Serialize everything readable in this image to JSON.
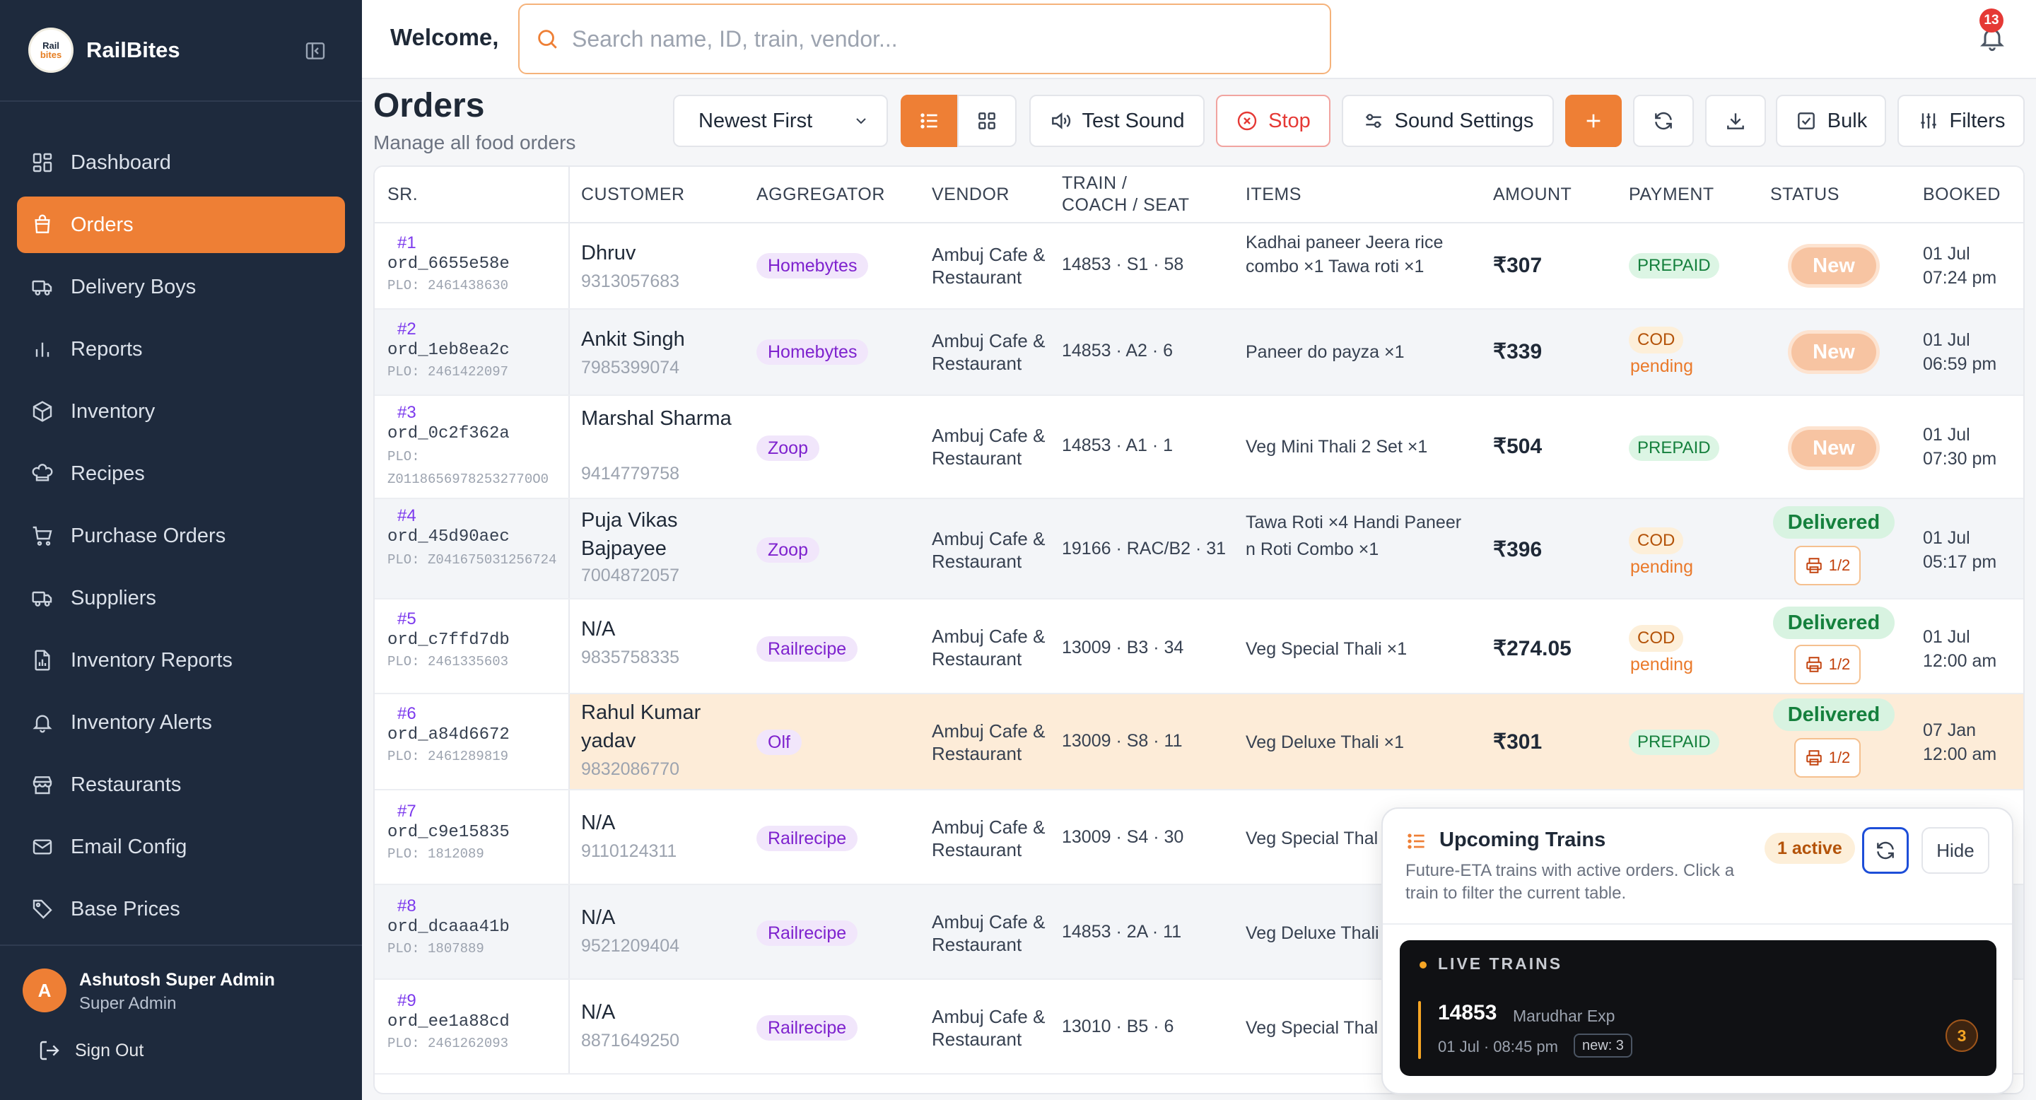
{
  "app": {
    "brand": "RailBites",
    "logo_top": "Rail",
    "logo_bottom": "bites"
  },
  "sidebar": {
    "items": [
      {
        "label": "Dashboard",
        "icon": "grid-icon"
      },
      {
        "label": "Orders",
        "icon": "bag-icon",
        "active": true
      },
      {
        "label": "Delivery Boys",
        "icon": "truck-icon"
      },
      {
        "label": "Reports",
        "icon": "bar-chart-icon"
      },
      {
        "label": "Inventory",
        "icon": "box-icon"
      },
      {
        "label": "Recipes",
        "icon": "chef-hat-icon"
      },
      {
        "label": "Purchase Orders",
        "icon": "cart-icon"
      },
      {
        "label": "Suppliers",
        "icon": "truck-icon"
      },
      {
        "label": "Inventory Reports",
        "icon": "file-chart-icon"
      },
      {
        "label": "Inventory Alerts",
        "icon": "bell-icon"
      },
      {
        "label": "Restaurants",
        "icon": "store-icon"
      },
      {
        "label": "Email Config",
        "icon": "mail-icon"
      },
      {
        "label": "Base Prices",
        "icon": "tag-icon"
      }
    ],
    "user": {
      "initial": "A",
      "name": "Ashutosh Super Admin",
      "role": "Super Admin"
    },
    "signout": "Sign Out"
  },
  "topbar": {
    "welcome": "Welcome,",
    "search_placeholder": "Search name, ID, train, vendor...",
    "notifications": "13"
  },
  "page": {
    "title": "Orders",
    "subtitle": "Manage all food orders"
  },
  "toolbar": {
    "sort": "Newest First",
    "test_sound": "Test Sound",
    "stop": "Stop",
    "sound_settings": "Sound Settings",
    "bulk": "Bulk",
    "filters": "Filters"
  },
  "columns": {
    "sr": "SR.",
    "customer": "CUSTOMER",
    "aggregator": "AGGREGATOR",
    "vendor": "VENDOR",
    "train_line1": "TRAIN /",
    "train_line2": "COACH / SEAT",
    "items": "ITEMS",
    "amount": "AMOUNT",
    "payment": "PAYMENT",
    "status": "STATUS",
    "booked": "BOOKED"
  },
  "orders": [
    {
      "sr": "#1",
      "id": "ord_6655e58e",
      "plo": "PLO: 2461438630",
      "name": "Dhruv",
      "phone": "9313057683",
      "aggregator": "Homebytes",
      "vendor": "Ambuj Cafe & Restaurant",
      "train": "14853 · S1 · 58",
      "items": "Kadhai paneer Jeera rice combo ×1 Tawa roti ×1",
      "amount": "₹307",
      "payment": "PREPAID",
      "status": "New",
      "date": "01 Jul",
      "time": "07:24 pm"
    },
    {
      "sr": "#2",
      "id": "ord_1eb8ea2c",
      "plo": "PLO: 2461422097",
      "name": "Ankit Singh",
      "phone": "7985399074",
      "aggregator": "Homebytes",
      "vendor": "Ambuj Cafe & Restaurant",
      "train": "14853 · A2 · 6",
      "items": "Paneer do payza ×1",
      "amount": "₹339",
      "payment": "COD",
      "payment_sub": "pending",
      "status": "New",
      "date": "01 Jul",
      "time": "06:59 pm"
    },
    {
      "sr": "#3",
      "id": "ord_0c2f362a",
      "plo": "PLO: Z01186569782532770O0",
      "name": "Marshal Sharma",
      "phone": "9414779758",
      "aggregator": "Zoop",
      "vendor": "Ambuj Cafe & Restaurant",
      "train": "14853 · A1 · 1",
      "items": "Veg Mini Thali 2 Set ×1",
      "amount": "₹504",
      "payment": "PREPAID",
      "status": "New",
      "date": "01 Jul",
      "time": "07:30 pm"
    },
    {
      "sr": "#4",
      "id": "ord_45d90aec",
      "plo": "PLO: Z041675031256724",
      "name": "Puja Vikas Bajpayee",
      "phone": "7004872057",
      "aggregator": "Zoop",
      "vendor": "Ambuj Cafe & Restaurant",
      "train": "19166 · RAC/B2 · 31",
      "items": "Tawa Roti ×4 Handi Paneer n Roti Combo ×1",
      "amount": "₹396",
      "payment": "COD",
      "payment_sub": "pending",
      "status": "Delivered",
      "print": "1/2",
      "date": "01 Jul",
      "time": "05:17 pm"
    },
    {
      "sr": "#5",
      "id": "ord_c7ffd7db",
      "plo": "PLO: 2461335603",
      "name": "N/A",
      "phone": "9835758335",
      "aggregator": "Railrecipe",
      "vendor": "Ambuj Cafe & Restaurant",
      "train": "13009 · B3 · 34",
      "items": "Veg Special Thali ×1",
      "amount": "₹274.05",
      "payment": "COD",
      "payment_sub": "pending",
      "status": "Delivered",
      "print": "1/2",
      "date": "01 Jul",
      "time": "12:00 am"
    },
    {
      "sr": "#6",
      "id": "ord_a84d6672",
      "plo": "PLO: 2461289819",
      "name": "Rahul Kumar yadav",
      "phone": "9832086770",
      "aggregator": "Olf",
      "vendor": "Ambuj Cafe & Restaurant",
      "train": "13009 · S8 · 11",
      "items": "Veg Deluxe Thali ×1",
      "amount": "₹301",
      "payment": "PREPAID",
      "status": "Delivered",
      "print": "1/2",
      "date": "07 Jan",
      "time": "12:00 am"
    },
    {
      "sr": "#7",
      "id": "ord_c9e15835",
      "plo": "PLO: 1812089",
      "name": "N/A",
      "phone": "9110124311",
      "aggregator": "Railrecipe",
      "vendor": "Ambuj Cafe & Restaurant",
      "train": "13009 · S4 · 30",
      "items": "Veg Special Thal"
    },
    {
      "sr": "#8",
      "id": "ord_dcaaa41b",
      "plo": "PLO: 1807889",
      "name": "N/A",
      "phone": "9521209404",
      "aggregator": "Railrecipe",
      "vendor": "Ambuj Cafe & Restaurant",
      "train": "14853 · 2A · 11",
      "items": "Veg Deluxe Thali"
    },
    {
      "sr": "#9",
      "id": "ord_ee1a88cd",
      "plo": "PLO: 2461262093",
      "name": "N/A",
      "phone": "8871649250",
      "aggregator": "Railrecipe",
      "vendor": "Ambuj Cafe & Restaurant",
      "train": "13010 · B5 · 6",
      "items": "Veg Special Thal"
    }
  ],
  "upcoming": {
    "title": "Upcoming Trains",
    "description": "Future-ETA trains with active orders. Click a train to filter the current table.",
    "active": "1 active",
    "hide": "Hide",
    "live_title": "LIVE TRAINS",
    "train": {
      "number": "14853",
      "name": "Marudhar Exp",
      "time": "01 Jul · 08:45 pm",
      "new": "new: 3",
      "count": "3"
    }
  },
  "colors": {
    "sidebar": "#1e2a3d",
    "accent": "#ee7f35",
    "prepaid": "#15803d",
    "cod": "#b45309",
    "aggregator": "#7e22ce"
  }
}
